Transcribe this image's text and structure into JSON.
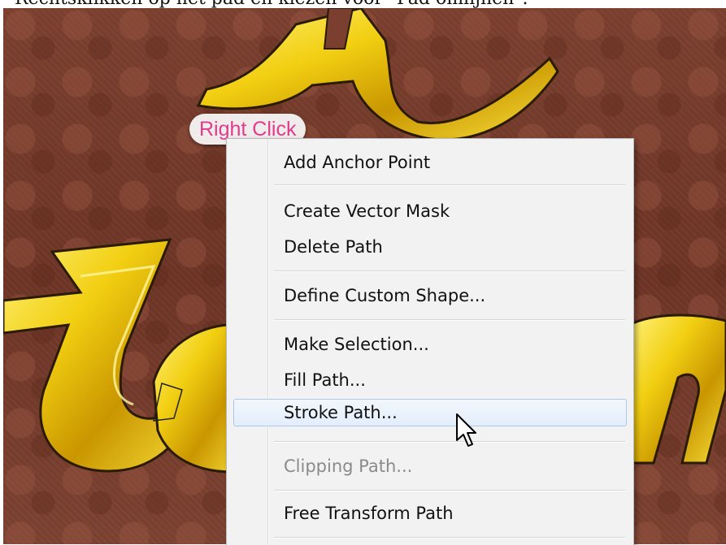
{
  "caption": "Rechtsklikken op het pad en kiezen voor \"Pad omlijnen\".",
  "hint_label": "Right Click",
  "menu": {
    "items": [
      {
        "label": "Add Anchor Point",
        "state": "normal"
      },
      {
        "label": "Create Vector Mask",
        "state": "normal"
      },
      {
        "label": "Delete Path",
        "state": "normal"
      },
      {
        "label": "Define Custom Shape...",
        "state": "normal"
      },
      {
        "label": "Make Selection...",
        "state": "normal"
      },
      {
        "label": "Fill Path...",
        "state": "normal"
      },
      {
        "label": "Stroke Path...",
        "state": "hover"
      },
      {
        "label": "Clipping Path...",
        "state": "disabled"
      },
      {
        "label": "Free Transform Path",
        "state": "normal"
      }
    ]
  },
  "colors": {
    "hint_text": "#e23b8c",
    "gold": "#f4d21c",
    "background": "#6f3728",
    "hover_border": "#a9c8ee"
  },
  "icons": [
    "mouse-pointer-icon"
  ]
}
